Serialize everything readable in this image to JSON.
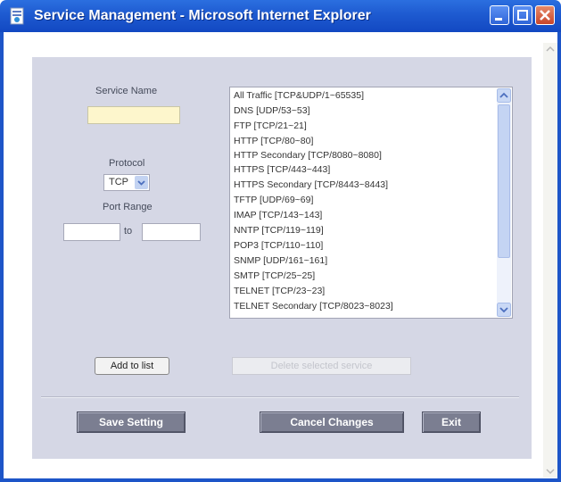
{
  "window": {
    "title": "Service Management - Microsoft Internet Explorer"
  },
  "form": {
    "service_name_label": "Service Name",
    "service_name_value": "",
    "protocol_label": "Protocol",
    "protocol_value": "TCP",
    "port_range_label": "Port Range",
    "port_from_value": "",
    "port_to_label": "to",
    "port_to_value": ""
  },
  "services": [
    "All Traffic [TCP&UDP/1~65535]",
    "DNS [UDP/53~53]",
    "FTP [TCP/21~21]",
    "HTTP [TCP/80~80]",
    "HTTP Secondary [TCP/8080~8080]",
    "HTTPS [TCP/443~443]",
    "HTTPS Secondary [TCP/8443~8443]",
    "TFTP [UDP/69~69]",
    "IMAP [TCP/143~143]",
    "NNTP [TCP/119~119]",
    "POP3 [TCP/110~110]",
    "SNMP [UDP/161~161]",
    "SMTP [TCP/25~25]",
    "TELNET [TCP/23~23]",
    "TELNET Secondary [TCP/8023~8023]"
  ],
  "buttons": {
    "add_to_list": "Add to list",
    "delete_selected": "Delete selected service",
    "save_setting": "Save Setting",
    "cancel_changes": "Cancel Changes",
    "exit": "Exit"
  },
  "icons": {
    "app": "ie-page-icon",
    "minimize": "minimize-icon",
    "maximize": "maximize-icon",
    "close": "close-icon"
  },
  "colors": {
    "titlebar": "#1e5ad0",
    "panel": "#d5d7e5",
    "highlight_input": "#fdf6cc",
    "dark_button": "#7b7e91"
  }
}
